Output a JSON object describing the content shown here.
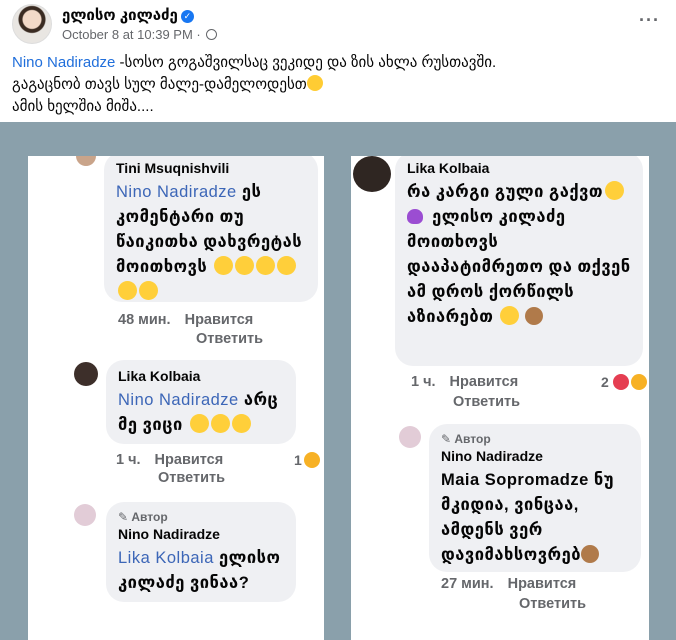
{
  "post": {
    "author": "ელისო კილაძე",
    "timestamp": "October 8 at 10:39 PM",
    "separator": "·",
    "more": "···",
    "mention": "Nino Nadiradze",
    "line1_rest": " -სოსო გოგაშვილსაც ვეკიდე და ზის ახლა რუსთავში.",
    "line2": "გაგაცნობ თავს სულ მალე-დამელოდესთ",
    "line3": "ამის ხელშია მიშა...."
  },
  "left": {
    "c1": {
      "name": "Tini Msuqnishvili",
      "mention": "Nino Nadiradze",
      "text": " ეს კომენტარი თუ წაიკითხა დახვრეტას მოითხოვს",
      "time": "48 мин.",
      "like": "Нравится",
      "reply": "Ответить"
    },
    "c2": {
      "name": "Lika Kolbaia",
      "mention": "Nino Nadiradze",
      "text": " არც მე ვიცი",
      "time": "1 ч.",
      "like": "Нравится",
      "reply": "Ответить",
      "reactions": "1"
    },
    "c3": {
      "author_tag": "✎ Автор",
      "name": "Nino Nadiradze",
      "mention": "Lika Kolbaia",
      "text": " ელისო კილაძე ვინაა?"
    }
  },
  "right": {
    "c1": {
      "name": "Lika Kolbaia",
      "text1": "რა კარგი გული გაქვთ",
      "text2": " ელისო კილაძე მოითხოვს დააპატიმრეთო და თქვენ ამ დროს ქორწილს აზიარებთ",
      "time": "1 ч.",
      "like": "Нравится",
      "reply": "Ответить",
      "reactions": "2"
    },
    "c2": {
      "author_tag": "✎ Автор",
      "name": "Nino Nadiradze",
      "text": "Maia Sopromadze ნუ მკიდია, ვინცაა, ამდენს ვერ დავიმახსოვრებ",
      "time": "27 мин.",
      "like": "Нравится",
      "reply": "Ответить"
    }
  },
  "colors": {
    "link": "#216fdb",
    "mention": "#3c66b7",
    "photo_bg": "#8aa0ab"
  },
  "icons": [
    "verified-badge-icon",
    "globe-icon",
    "more-options-icon"
  ]
}
